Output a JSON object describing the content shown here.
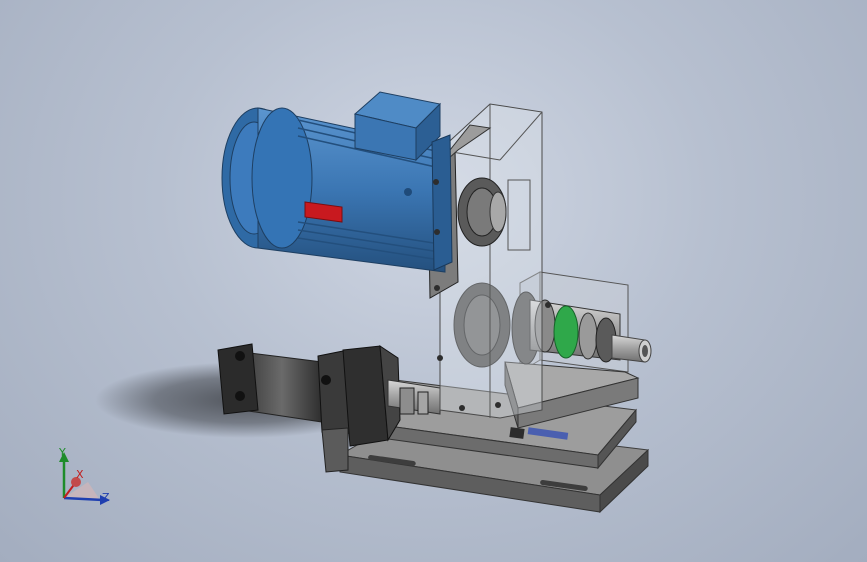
{
  "viewport": {
    "background_top": "#cfd6e3",
    "background_bottom": "#a3adbf"
  },
  "model": {
    "motor_color": "#3b76b3",
    "frame_color": "#6e6e6e",
    "belt_guard": "transparent",
    "coupling_color": "#2fa84a",
    "nameplate_color": "#c8191f"
  },
  "triad": {
    "y_label": "Y",
    "x_label": "X",
    "z_label": "Z",
    "y_color": "#1e8c2a",
    "x_color": "#c21d1d",
    "z_color": "#1f3fb0"
  }
}
